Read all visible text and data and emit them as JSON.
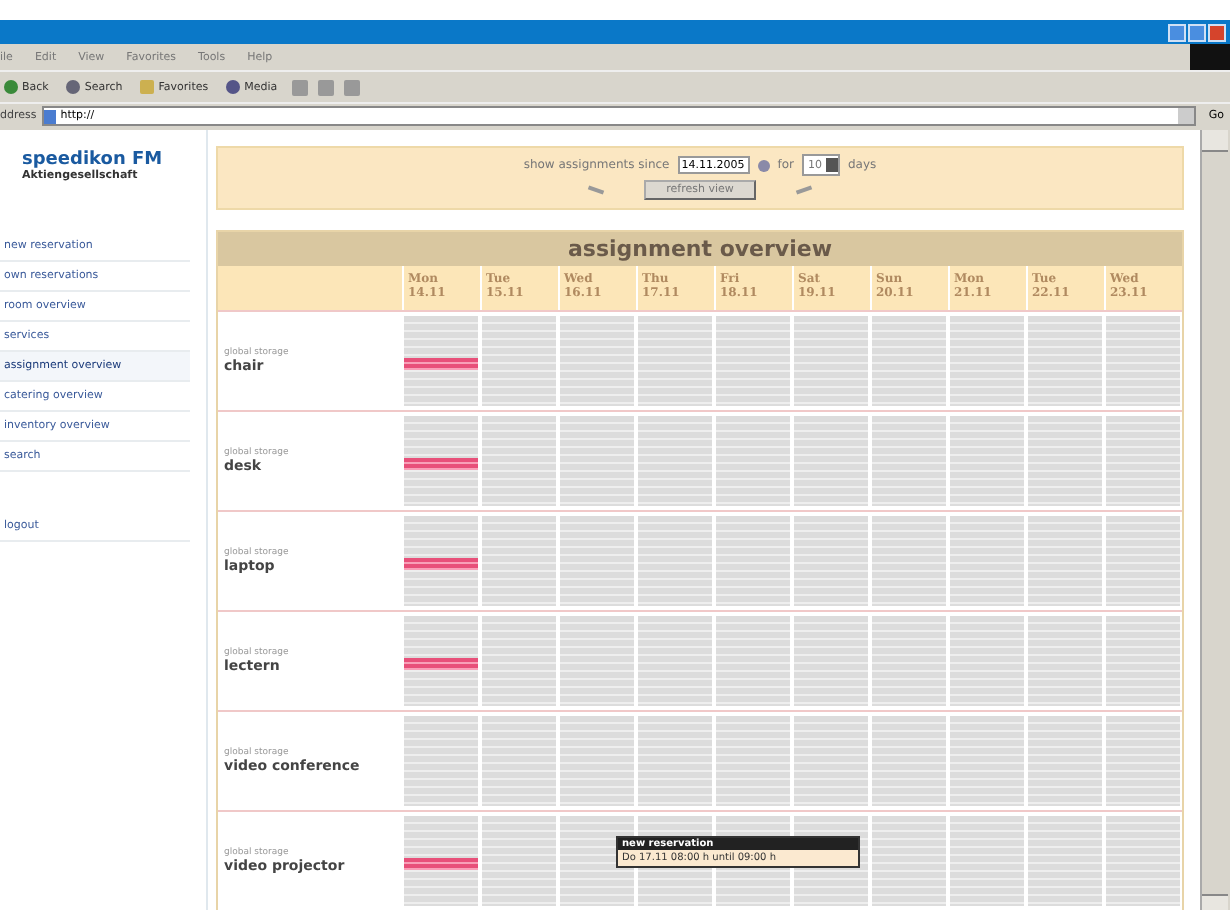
{
  "menu": [
    "ile",
    "Edit",
    "View",
    "Favorites",
    "Tools",
    "Help"
  ],
  "toolbar": [
    {
      "label": "Back",
      "kind": "back"
    },
    {
      "label": "Search",
      "kind": "search"
    },
    {
      "label": "Favorites",
      "kind": "favorites"
    },
    {
      "label": "Media",
      "kind": "media"
    }
  ],
  "address": {
    "label": "ddress",
    "value": "http://",
    "go": "Go"
  },
  "logo": {
    "title": "speedikon FM",
    "subtitle": "Aktiengesellschaft"
  },
  "nav": [
    {
      "label": "new reservation",
      "selected": false
    },
    {
      "label": "own reservations",
      "selected": false
    },
    {
      "label": "room overview",
      "selected": false
    },
    {
      "label": "services",
      "selected": false
    },
    {
      "label": "assignment overview",
      "selected": true
    },
    {
      "label": "catering overview",
      "selected": false
    },
    {
      "label": "inventory overview",
      "selected": false
    },
    {
      "label": "search",
      "selected": false
    }
  ],
  "logout": "logout",
  "filter": {
    "label_since": "show assignments since",
    "date": "14.11.2005",
    "label_for": "for",
    "days": "10",
    "label_days": "days",
    "refresh": "refresh view"
  },
  "title": "assignment overview",
  "columns": [
    {
      "day": "Mon",
      "date": "14.11"
    },
    {
      "day": "Tue",
      "date": "15.11"
    },
    {
      "day": "Wed",
      "date": "16.11"
    },
    {
      "day": "Thu",
      "date": "17.11"
    },
    {
      "day": "Fri",
      "date": "18.11"
    },
    {
      "day": "Sat",
      "date": "19.11"
    },
    {
      "day": "Sun",
      "date": "20.11"
    },
    {
      "day": "Mon",
      "date": "21.11"
    },
    {
      "day": "Tue",
      "date": "22.11"
    },
    {
      "day": "Wed",
      "date": "23.11"
    }
  ],
  "rows": [
    {
      "location": "global storage",
      "name": "chair",
      "reserved": [
        true,
        false,
        false,
        false,
        false,
        false,
        false,
        false,
        false,
        false
      ]
    },
    {
      "location": "global storage",
      "name": "desk",
      "reserved": [
        true,
        false,
        false,
        false,
        false,
        false,
        false,
        false,
        false,
        false
      ]
    },
    {
      "location": "global storage",
      "name": "laptop",
      "reserved": [
        true,
        false,
        false,
        false,
        false,
        false,
        false,
        false,
        false,
        false
      ]
    },
    {
      "location": "global storage",
      "name": "lectern",
      "reserved": [
        true,
        false,
        false,
        false,
        false,
        false,
        false,
        false,
        false,
        false
      ]
    },
    {
      "location": "global storage",
      "name": "video conference",
      "reserved": [
        false,
        false,
        false,
        false,
        false,
        false,
        false,
        false,
        false,
        false
      ]
    },
    {
      "location": "global storage",
      "name": "video projector",
      "reserved": [
        true,
        false,
        false,
        false,
        false,
        false,
        false,
        false,
        false,
        false
      ]
    }
  ],
  "tooltip": {
    "title": "new reservation",
    "text": "Do 17.11 08:00 h until 09:00 h"
  }
}
